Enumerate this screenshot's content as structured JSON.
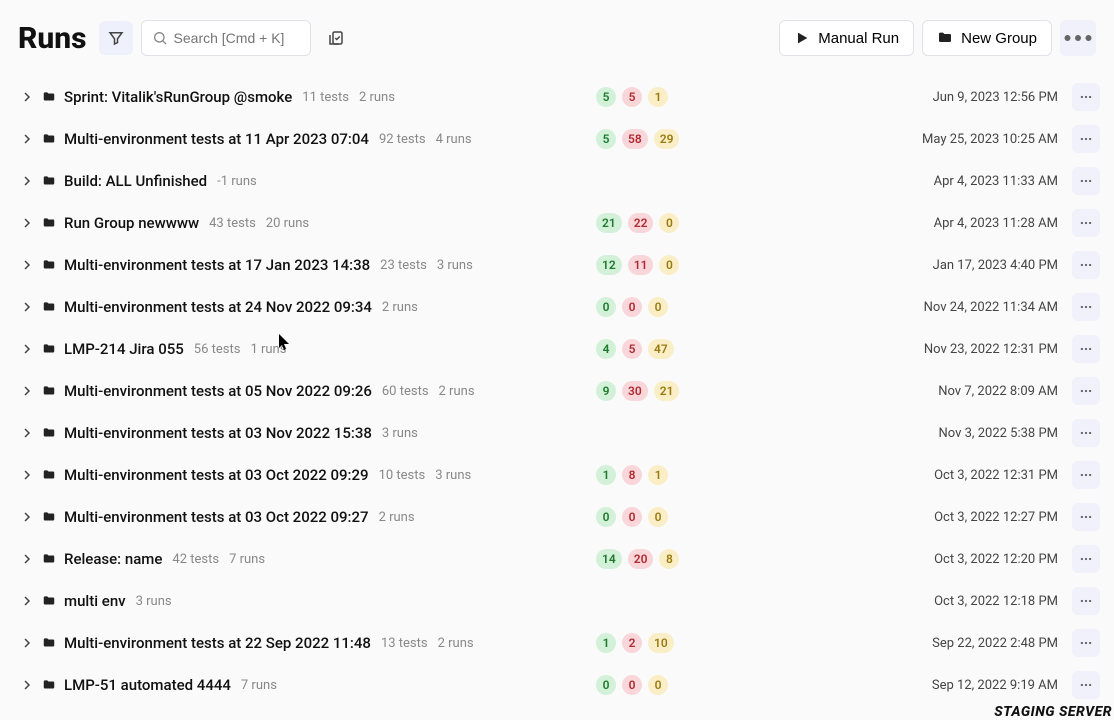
{
  "header": {
    "title": "Runs",
    "search_placeholder": "Search [Cmd + K]",
    "manual_run": "Manual Run",
    "new_group": "New Group"
  },
  "footer": {
    "staging": "STAGING SERVER"
  },
  "rows": [
    {
      "name": "Sprint: Vitalik'sRunGroup @smoke",
      "tests": "11 tests",
      "runs": "2 runs",
      "badges": [
        "5",
        "5",
        "1"
      ],
      "ts": "Jun 9, 2023 12:56 PM"
    },
    {
      "name": "Multi-environment tests at 11 Apr 2023 07:04",
      "tests": "92 tests",
      "runs": "4 runs",
      "badges": [
        "5",
        "58",
        "29"
      ],
      "ts": "May 25, 2023 10:25 AM"
    },
    {
      "name": "Build: ALL Unfinished",
      "tests": null,
      "runs": "-1 runs",
      "badges": null,
      "ts": "Apr 4, 2023 11:33 AM"
    },
    {
      "name": "Run Group newwww",
      "tests": "43 tests",
      "runs": "20 runs",
      "badges": [
        "21",
        "22",
        "0"
      ],
      "ts": "Apr 4, 2023 11:28 AM"
    },
    {
      "name": "Multi-environment tests at 17 Jan 2023 14:38",
      "tests": "23 tests",
      "runs": "3 runs",
      "badges": [
        "12",
        "11",
        "0"
      ],
      "ts": "Jan 17, 2023 4:40 PM"
    },
    {
      "name": "Multi-environment tests at 24 Nov 2022 09:34",
      "tests": null,
      "runs": "2 runs",
      "badges": [
        "0",
        "0",
        "0"
      ],
      "ts": "Nov 24, 2022 11:34 AM"
    },
    {
      "name": "LMP-214 Jira 055",
      "tests": "56 tests",
      "runs": "1 runs",
      "badges": [
        "4",
        "5",
        "47"
      ],
      "ts": "Nov 23, 2022 12:31 PM"
    },
    {
      "name": "Multi-environment tests at 05 Nov 2022 09:26",
      "tests": "60 tests",
      "runs": "2 runs",
      "badges": [
        "9",
        "30",
        "21"
      ],
      "ts": "Nov 7, 2022 8:09 AM"
    },
    {
      "name": "Multi-environment tests at 03 Nov 2022 15:38",
      "tests": null,
      "runs": "3 runs",
      "badges": null,
      "ts": "Nov 3, 2022 5:38 PM"
    },
    {
      "name": "Multi-environment tests at 03 Oct 2022 09:29",
      "tests": "10 tests",
      "runs": "3 runs",
      "badges": [
        "1",
        "8",
        "1"
      ],
      "ts": "Oct 3, 2022 12:31 PM"
    },
    {
      "name": "Multi-environment tests at 03 Oct 2022 09:27",
      "tests": null,
      "runs": "2 runs",
      "badges": [
        "0",
        "0",
        "0"
      ],
      "ts": "Oct 3, 2022 12:27 PM"
    },
    {
      "name": "Release: name",
      "tests": "42 tests",
      "runs": "7 runs",
      "badges": [
        "14",
        "20",
        "8"
      ],
      "ts": "Oct 3, 2022 12:20 PM"
    },
    {
      "name": "multi env",
      "tests": null,
      "runs": "3 runs",
      "badges": null,
      "ts": "Oct 3, 2022 12:18 PM"
    },
    {
      "name": "Multi-environment tests at 22 Sep 2022 11:48",
      "tests": "13 tests",
      "runs": "2 runs",
      "badges": [
        "1",
        "2",
        "10"
      ],
      "ts": "Sep 22, 2022 2:48 PM"
    },
    {
      "name": "LMP-51 automated 4444",
      "tests": null,
      "runs": "7 runs",
      "badges": [
        "0",
        "0",
        "0"
      ],
      "ts": "Sep 12, 2022 9:19 AM"
    }
  ]
}
